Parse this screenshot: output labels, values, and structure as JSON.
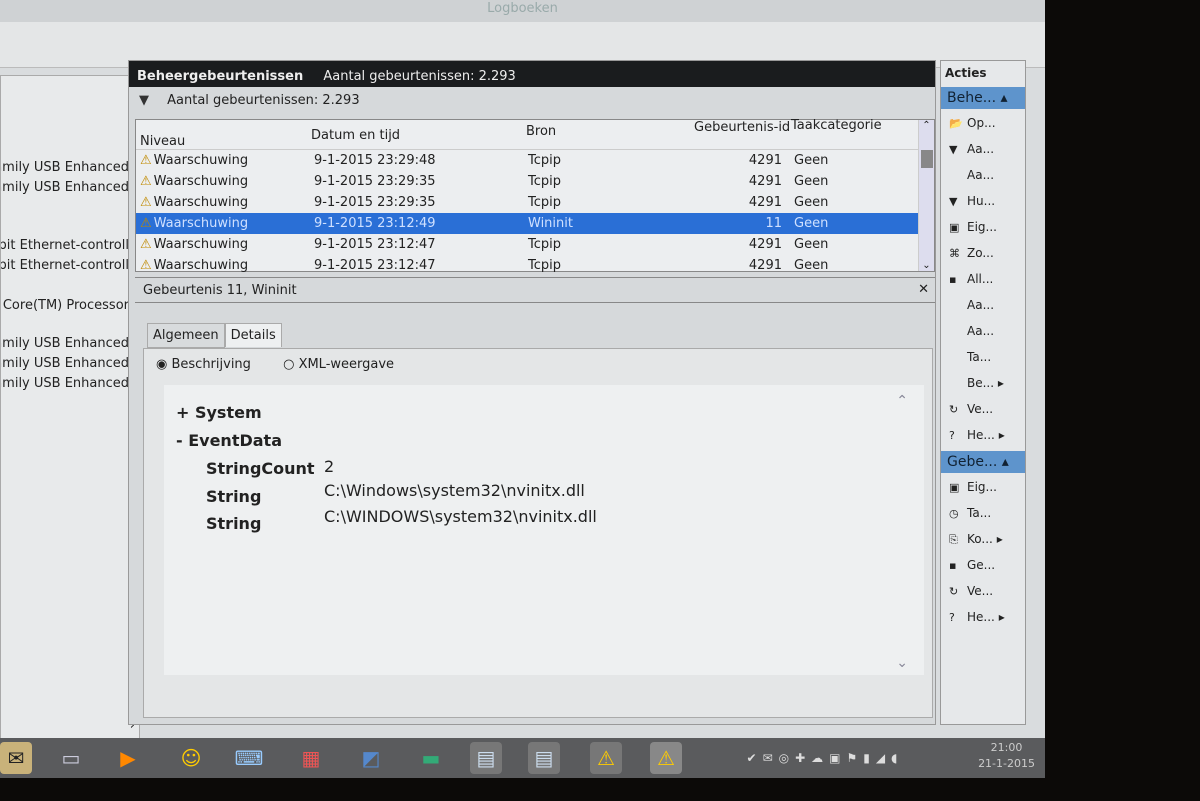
{
  "window": {
    "title": "Logboeken"
  },
  "left_panel": {
    "items": [
      "Family USB Enhanced",
      "Family USB Enhanced",
      "Gigabit Ethernet-controll",
      "Gigabit Ethernet-controll",
      "Intel(R) Core(TM) Processor",
      "Family USB Enhanced",
      "Family USB Enhanced",
      "Family USB Enhanced"
    ]
  },
  "header": {
    "title": "Beheergebeurtenissen",
    "count": "Aantal gebeurtenissen: 2.293"
  },
  "filter": {
    "text": "Aantal gebeurtenissen: 2.293"
  },
  "table": {
    "columns": [
      "Niveau",
      "Datum en tijd",
      "Bron",
      "Gebeurtenis-id",
      "Taakcategorie"
    ],
    "rows": [
      {
        "level": "Waarschuwing",
        "date": "9-1-2015 23:29:48",
        "source": "Tcpip",
        "id": "4291",
        "category": "Geen"
      },
      {
        "level": "Waarschuwing",
        "date": "9-1-2015 23:29:35",
        "source": "Tcpip",
        "id": "4291",
        "category": "Geen"
      },
      {
        "level": "Waarschuwing",
        "date": "9-1-2015 23:29:35",
        "source": "Tcpip",
        "id": "4291",
        "category": "Geen"
      },
      {
        "level": "Waarschuwing",
        "date": "9-1-2015 23:12:49",
        "source": "Wininit",
        "id": "11",
        "category": "Geen",
        "selected": true
      },
      {
        "level": "Waarschuwing",
        "date": "9-1-2015 23:12:47",
        "source": "Tcpip",
        "id": "4291",
        "category": "Geen"
      },
      {
        "level": "Waarschuwing",
        "date": "9-1-2015 23:12:47",
        "source": "Tcpip",
        "id": "4291",
        "category": "Geen"
      }
    ]
  },
  "details": {
    "title": "Gebeurtenis 11, Wininit",
    "tabs": [
      "Algemeen",
      "Details"
    ],
    "radio": [
      "Beschrijving",
      "XML-weergave"
    ],
    "system": "+ System",
    "eventdata": "- EventData",
    "fields": [
      {
        "k": "StringCount",
        "v": "2"
      },
      {
        "k": "String",
        "v": "C:\\Windows\\system32\\nvinitx.dll"
      },
      {
        "k": "String",
        "v": "C:\\WINDOWS\\system32\\nvinitx.dll"
      }
    ]
  },
  "actions": {
    "title": "Acties",
    "sec1": "Behe...",
    "items1": [
      "Op...",
      "Aa...",
      "Aa...",
      "Hu...",
      "Eig...",
      "Zo...",
      "All...",
      "Aa...",
      "Aa...",
      "Ta...",
      "Be...",
      "Ve...",
      "He..."
    ],
    "sec2": "Gebe...",
    "items2": [
      "Eig...",
      "Ta...",
      "Ko...",
      "Ge...",
      "Ve...",
      "He..."
    ]
  },
  "tray": {
    "time": "21:00",
    "date": "21-1-2015"
  },
  "colors": {
    "selection": "#2a6fd6",
    "warning": "#c08a00"
  }
}
